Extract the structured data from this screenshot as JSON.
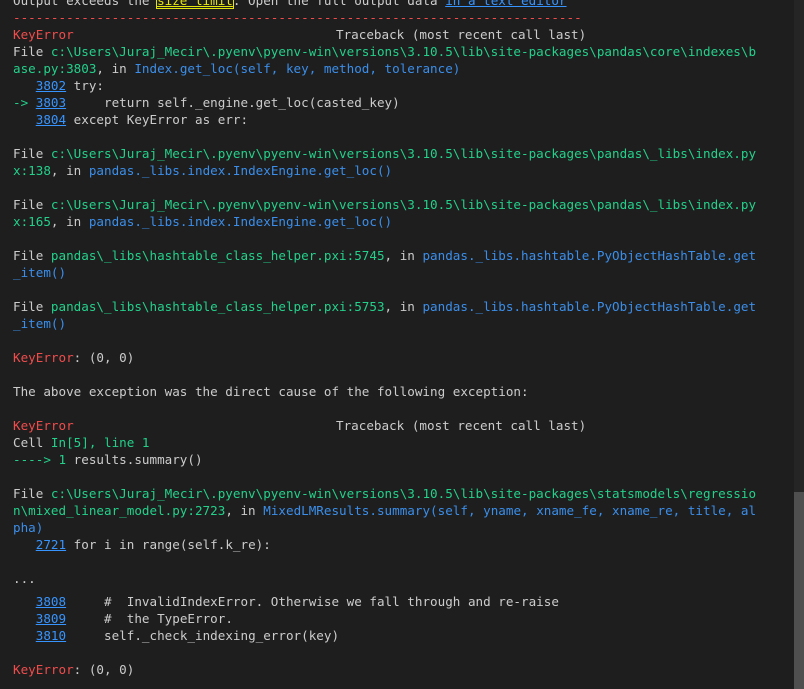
{
  "header": {
    "prefix": "Output exceeds the ",
    "size_limit": "size limit",
    "middle": ". Open the full output data ",
    "text_editor": "in a text editor",
    "separator": "---------------------------------------------------------------------------"
  },
  "tb1": {
    "error_name": "KeyError",
    "traceback_label": "Traceback (most recent call last)",
    "frame1": {
      "file_kw": "File ",
      "path_a": "c:\\Users\\Juraj_Mecir\\.pyenv\\pyenv-win\\versions\\3.10.5\\lib\\site-packages\\pandas\\core\\indexes\\b",
      "path_b": "ase.py:3803",
      "in_kw": ", in ",
      "func": "Index.get_loc(self, key, method, tolerance)",
      "code": [
        {
          "prefix": "   ",
          "num": "3802",
          "text": " try:"
        },
        {
          "prefix": "-> ",
          "num": "3803",
          "text": "     return self._engine.get_loc(casted_key)"
        },
        {
          "prefix": "   ",
          "num": "3804",
          "text": " except KeyError as err:"
        }
      ]
    },
    "frame2": {
      "file_kw": "File ",
      "path_a": "c:\\Users\\Juraj_Mecir\\.pyenv\\pyenv-win\\versions\\3.10.5\\lib\\site-packages\\pandas\\_libs\\index.py",
      "path_b": "x:138",
      "in_kw": ", in ",
      "func": "pandas._libs.index.IndexEngine.get_loc()"
    },
    "frame3": {
      "file_kw": "File ",
      "path_a": "c:\\Users\\Juraj_Mecir\\.pyenv\\pyenv-win\\versions\\3.10.5\\lib\\site-packages\\pandas\\_libs\\index.py",
      "path_b": "x:165",
      "in_kw": ", in ",
      "func": "pandas._libs.index.IndexEngine.get_loc()"
    },
    "frame4": {
      "file_kw": "File ",
      "path": "pandas\\_libs\\hashtable_class_helper.pxi:5745",
      "in_kw": ", in ",
      "func_a": "pandas._libs.hashtable.PyObjectHashTable.get",
      "func_b": "_item()"
    },
    "frame5": {
      "file_kw": "File ",
      "path": "pandas\\_libs\\hashtable_class_helper.pxi:5753",
      "in_kw": ", in ",
      "func_a": "pandas._libs.hashtable.PyObjectHashTable.get",
      "func_b": "_item()"
    },
    "final_name": "KeyError",
    "final_msg": ": (0, 0)"
  },
  "cause_text": "The above exception was the direct cause of the following exception:",
  "tb2": {
    "error_name": "KeyError",
    "traceback_label": "Traceback (most recent call last)",
    "cell_kw": "Cell ",
    "cell_ref": "In[5], line 1",
    "arrow": "----> 1",
    "arrow_code": " results.summary()",
    "frame1": {
      "file_kw": "File ",
      "path_a": "c:\\Users\\Juraj_Mecir\\.pyenv\\pyenv-win\\versions\\3.10.5\\lib\\site-packages\\statsmodels\\regressio",
      "path_b": "n\\mixed_linear_model.py:2723",
      "in_kw": ", in ",
      "func_a": "MixedLMResults.summary(self, yname, xname_fe, xname_re, title, al",
      "func_b": "pha)",
      "code_num": "2721",
      "code_text": " for i in range(self.k_re):"
    },
    "ellipsis": "...",
    "tail_code": [
      {
        "num": "3808",
        "text": "     #  InvalidIndexError. Otherwise we fall through and re-raise"
      },
      {
        "num": "3809",
        "text": "     #  the TypeError."
      },
      {
        "num": "3810",
        "text": "     self._check_indexing_error(key)"
      }
    ],
    "final_name": "KeyError",
    "final_msg": ": (0, 0)"
  }
}
